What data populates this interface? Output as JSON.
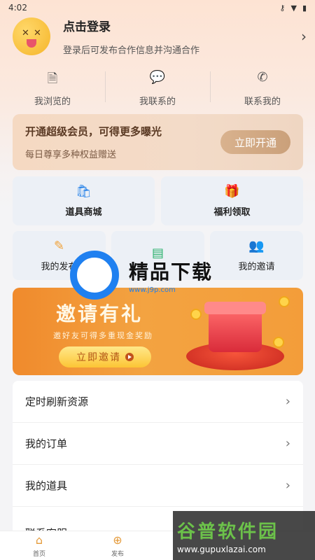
{
  "status_bar": {
    "time": "4:02",
    "icons": [
      "key-icon",
      "wifi-icon",
      "battery-icon"
    ]
  },
  "profile": {
    "title": "点击登录",
    "subtitle": "登录后可发布合作信息并沟通合作"
  },
  "quick_links": [
    {
      "label": "我浏览的",
      "icon": "document-icon"
    },
    {
      "label": "我联系的",
      "icon": "chat-icon"
    },
    {
      "label": "联系我的",
      "icon": "phone-icon"
    }
  ],
  "vip": {
    "title": "开通超级会员，可得更多曝光",
    "subtitle": "每日尊享多种权益赠送",
    "button": "立即开通"
  },
  "features": [
    {
      "label": "道具商城",
      "icon": "shopping-bag-icon",
      "color": "#1f7ee8"
    },
    {
      "label": "福利领取",
      "icon": "gift-icon",
      "color": "#e8456a"
    },
    {
      "label": "我的发布",
      "icon": "edit-icon",
      "color": "#f0a035"
    },
    {
      "label": "",
      "icon": "contact-card-icon",
      "color": "#27b06a"
    },
    {
      "label": "我的邀请",
      "icon": "add-user-icon",
      "color": "#6a50d8"
    }
  ],
  "invite": {
    "title": "邀请有礼",
    "subtitle": "邀好友可得多重现金奖励",
    "button": "立即邀请"
  },
  "menu": [
    {
      "label": "定时刷新资源"
    },
    {
      "label": "我的订单"
    },
    {
      "label": "我的道具"
    },
    {
      "label": "联系客服"
    }
  ],
  "bottom_nav": [
    {
      "label": "首页",
      "icon": "home-icon"
    },
    {
      "label": "发布",
      "icon": "plus-circle-icon"
    }
  ],
  "watermarks": {
    "center_text": "精品下载",
    "center_url": "www.j9p.com",
    "corner_text": "谷普软件园",
    "corner_url": "www.gupuxlazai.com"
  },
  "colors": {
    "accent": "#f08a2c",
    "vip_button": "#caa07a",
    "nav_accent": "#e49a3a"
  }
}
